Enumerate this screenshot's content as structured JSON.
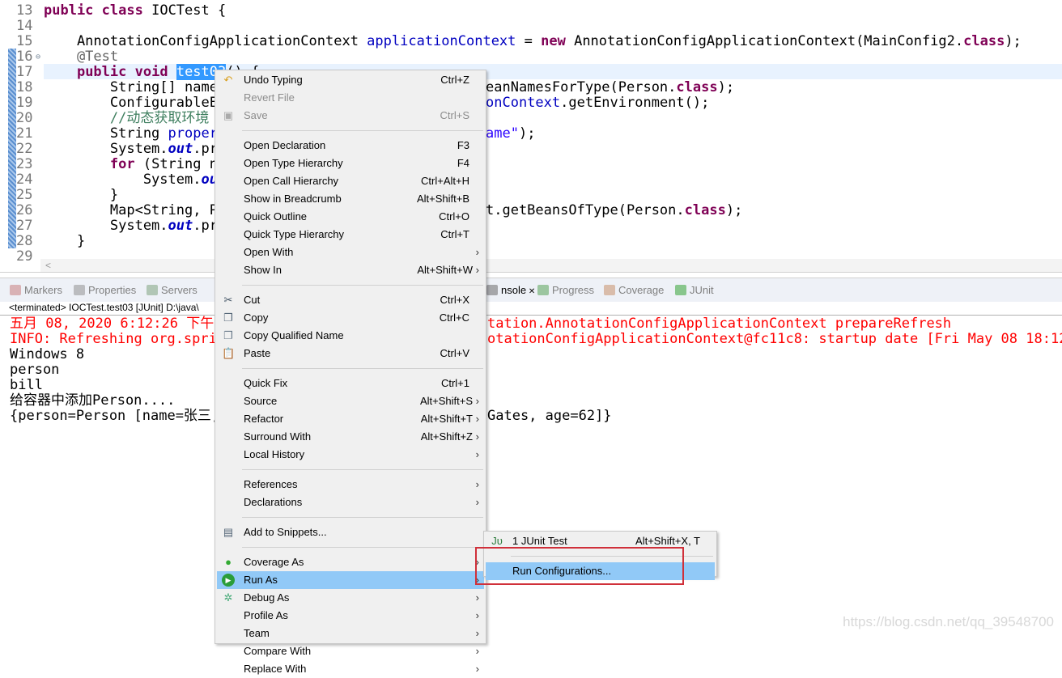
{
  "editor": {
    "line_numbers": [
      "13",
      "14",
      "15",
      "16",
      "17",
      "18",
      "19",
      "20",
      "21",
      "22",
      "23",
      "24",
      "25",
      "26",
      "27",
      "28",
      "29"
    ],
    "fold_icon": "collapse-icon",
    "lines": [
      [
        [
          "public",
          "kw"
        ],
        [
          " ",
          ""
        ],
        [
          "class",
          "kw"
        ],
        [
          " IOCTest {",
          ""
        ]
      ],
      [],
      [
        [
          "    AnnotationConfigApplicationContext ",
          ""
        ],
        [
          "applicationContext",
          "fld"
        ],
        [
          " = ",
          ""
        ],
        [
          "new",
          "kw"
        ],
        [
          " AnnotationConfigApplicationContext(MainConfig2.",
          ""
        ],
        [
          "class",
          "kw"
        ],
        [
          ");",
          ""
        ]
      ],
      [
        [
          "    @Test",
          "an"
        ]
      ],
      [
        [
          "    ",
          ""
        ],
        [
          "public",
          "kw"
        ],
        [
          " ",
          ""
        ],
        [
          "void",
          "kw"
        ],
        [
          " ",
          ""
        ],
        [
          "test03",
          "sel"
        ],
        [
          "() {",
          ""
        ]
      ],
      [
        [
          "        String[] name",
          ""
        ]
      ],
      [
        [
          "        ConfigurableE",
          ""
        ]
      ],
      [
        [
          "        //动态获取环境",
          "cm"
        ]
      ],
      [
        [
          "        String ",
          ""
        ],
        [
          "proper",
          "fld"
        ]
      ],
      [
        [
          "        System.",
          ""
        ],
        [
          "out",
          "sf"
        ],
        [
          ".pr",
          ""
        ]
      ],
      [
        [
          "        ",
          ""
        ],
        [
          "for",
          "kw"
        ],
        [
          " (String n",
          ""
        ]
      ],
      [
        [
          "            System.",
          ""
        ],
        [
          "ou",
          "sf"
        ]
      ],
      [
        [
          "        }",
          ""
        ]
      ],
      [
        [
          "        Map<String, P",
          ""
        ]
      ],
      [
        [
          "        System.",
          ""
        ],
        [
          "out",
          "sf"
        ],
        [
          ".pr",
          ""
        ]
      ],
      [
        [
          "    }",
          ""
        ]
      ],
      []
    ],
    "right_fragments": [
      {
        "line": "18",
        "tokens": [
          [
            "eanNamesForType(Person.",
            ""
          ],
          [
            "class",
            "kw"
          ],
          [
            ");",
            ""
          ]
        ]
      },
      {
        "line": "19",
        "tokens": [
          [
            "onContext",
            "fld"
          ],
          [
            ".getEnvironment();",
            ""
          ]
        ]
      },
      {
        "line": "21",
        "tokens": [
          [
            "ame\"",
            "str"
          ],
          [
            ");",
            ""
          ]
        ]
      },
      {
        "line": "26",
        "tokens": [
          [
            "t.getBeansOfType(Person.",
            ""
          ],
          [
            "class",
            "kw"
          ],
          [
            ");",
            ""
          ]
        ]
      }
    ]
  },
  "panel": {
    "tabs": [
      {
        "label": "Markers",
        "icon": "markers-icon"
      },
      {
        "label": "Properties",
        "icon": "properties-icon"
      },
      {
        "label": "Servers",
        "icon": "servers-icon"
      },
      {
        "label": "nsole",
        "icon": "console-icon",
        "active": true
      },
      {
        "label": "Progress",
        "icon": "progress-icon"
      },
      {
        "label": "Coverage",
        "icon": "coverage-icon"
      },
      {
        "label": "JUnit",
        "icon": "junit-icon"
      }
    ],
    "status": "<terminated> IOCTest.test03 [JUnit] D:\\java\\"
  },
  "console": {
    "lines": [
      {
        "left": "五月 08, 2020 6:12:26 下午",
        "right": "tation.AnnotationConfigApplicationContext prepareRefresh",
        "red": true
      },
      {
        "left": "INFO: Refreshing org.sprin",
        "right": "otationConfigApplicationContext@fc11c8: startup date [Fri May 08 18:12:",
        "red": true
      },
      {
        "left": "Windows 8",
        "right": ""
      },
      {
        "left": "person",
        "right": ""
      },
      {
        "left": "bill",
        "right": ""
      },
      {
        "left": "给容器中添加Person....",
        "right": ""
      },
      {
        "left": "{person=Person [name=张三,",
        "right": "Gates, age=62]}"
      }
    ]
  },
  "context_menu": {
    "items": [
      {
        "label": "Undo Typing",
        "shortcut": "Ctrl+Z",
        "icon": "undo-icon"
      },
      {
        "label": "Revert File",
        "disabled": true
      },
      {
        "label": "Save",
        "shortcut": "Ctrl+S",
        "disabled": true,
        "icon": "save-icon"
      },
      {
        "sep": true
      },
      {
        "label": "Open Declaration",
        "shortcut": "F3"
      },
      {
        "label": "Open Type Hierarchy",
        "shortcut": "F4"
      },
      {
        "label": "Open Call Hierarchy",
        "shortcut": "Ctrl+Alt+H"
      },
      {
        "label": "Show in Breadcrumb",
        "shortcut": "Alt+Shift+B"
      },
      {
        "label": "Quick Outline",
        "shortcut": "Ctrl+O"
      },
      {
        "label": "Quick Type Hierarchy",
        "shortcut": "Ctrl+T"
      },
      {
        "label": "Open With",
        "submenu": true
      },
      {
        "label": "Show In",
        "shortcut": "Alt+Shift+W",
        "submenu": true
      },
      {
        "sep": true
      },
      {
        "label": "Cut",
        "shortcut": "Ctrl+X",
        "icon": "cut-icon"
      },
      {
        "label": "Copy",
        "shortcut": "Ctrl+C",
        "icon": "copy-icon"
      },
      {
        "label": "Copy Qualified Name",
        "icon": "copy-qualified-name-icon"
      },
      {
        "label": "Paste",
        "shortcut": "Ctrl+V",
        "icon": "paste-icon"
      },
      {
        "sep": true
      },
      {
        "label": "Quick Fix",
        "shortcut": "Ctrl+1"
      },
      {
        "label": "Source",
        "shortcut": "Alt+Shift+S",
        "submenu": true
      },
      {
        "label": "Refactor",
        "shortcut": "Alt+Shift+T",
        "submenu": true
      },
      {
        "label": "Surround With",
        "shortcut": "Alt+Shift+Z",
        "submenu": true
      },
      {
        "label": "Local History",
        "submenu": true
      },
      {
        "sep": true
      },
      {
        "label": "References",
        "submenu": true
      },
      {
        "label": "Declarations",
        "submenu": true
      },
      {
        "sep": true
      },
      {
        "label": "Add to Snippets...",
        "icon": "snippets-icon"
      },
      {
        "sep": true
      },
      {
        "label": "Coverage As",
        "submenu": true,
        "icon": "coverage-icon"
      },
      {
        "label": "Run As",
        "submenu": true,
        "icon": "run-icon",
        "highlighted": true
      },
      {
        "label": "Debug As",
        "submenu": true,
        "icon": "debug-icon"
      },
      {
        "label": "Profile As",
        "submenu": true
      },
      {
        "label": "Team",
        "submenu": true
      },
      {
        "label": "Compare With",
        "submenu": true
      },
      {
        "label": "Replace With",
        "submenu": true
      }
    ]
  },
  "submenu": {
    "items": [
      {
        "label": "1 JUnit Test",
        "shortcut": "Alt+Shift+X, T",
        "icon": "junit-icon"
      },
      {
        "sep": true
      },
      {
        "label": "Run Configurations...",
        "highlighted": true
      }
    ]
  },
  "colors": {
    "menu_highlight": "#91c9f7",
    "annotation_box": "#d0303a",
    "keyword": "#7f0055",
    "field": "#0000c0",
    "console_error": "#ff0000"
  },
  "watermark": "https://blog.csdn.net/qq_39548700"
}
